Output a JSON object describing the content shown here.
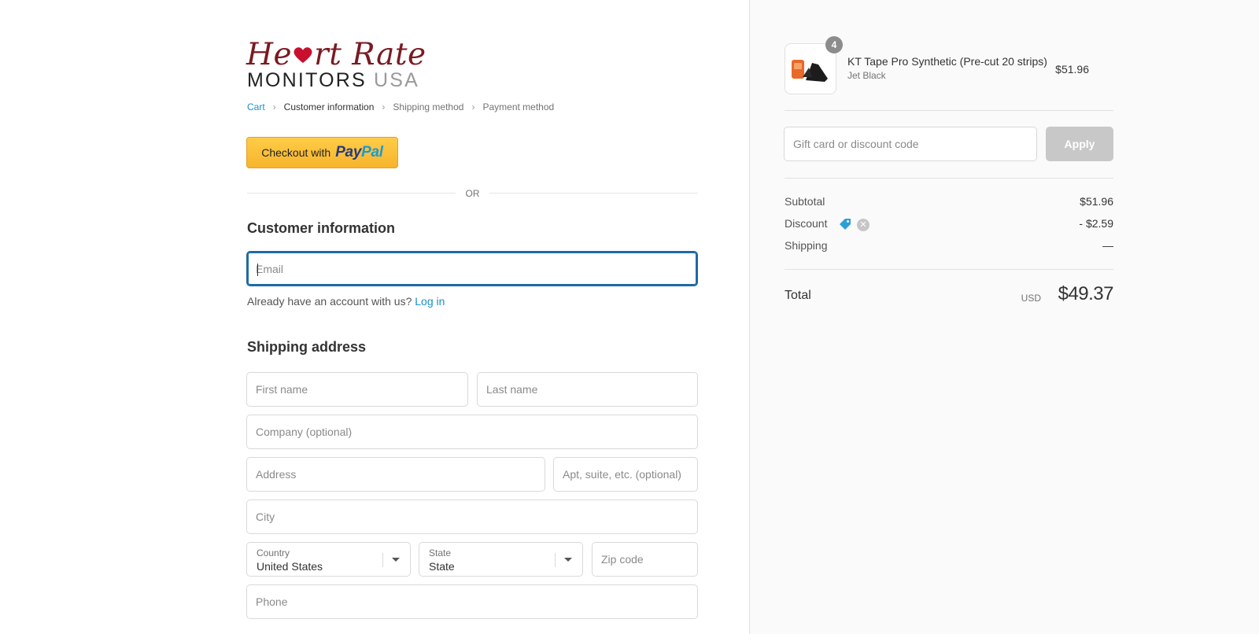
{
  "brand": {
    "logo_line1_left": "He",
    "logo_line1_right": "rt Rate",
    "logo_line2_main": "MONITORS",
    "logo_line2_suffix": "USA",
    "logo_color": "#7a1a22"
  },
  "breadcrumb": {
    "items": [
      {
        "label": "Cart",
        "state": "link"
      },
      {
        "label": "Customer information",
        "state": "current"
      },
      {
        "label": "Shipping method",
        "state": "upcoming"
      },
      {
        "label": "Payment method",
        "state": "upcoming"
      }
    ],
    "separator_icon": "chevron-right-icon"
  },
  "paypal": {
    "prefix": "Checkout with",
    "brand_part1": "Pay",
    "brand_part2": "Pal"
  },
  "divider_text": "OR",
  "customer_info": {
    "title": "Customer information",
    "email_placeholder": "Email",
    "email_value": "",
    "account_prompt": "Already have an account with us?",
    "login_link": "Log in"
  },
  "shipping": {
    "title": "Shipping address",
    "first_name_placeholder": "First name",
    "last_name_placeholder": "Last name",
    "company_placeholder": "Company (optional)",
    "address_placeholder": "Address",
    "apt_placeholder": "Apt, suite, etc. (optional)",
    "city_placeholder": "City",
    "country_label": "Country",
    "country_value": "United States",
    "state_label": "State",
    "state_value": "State",
    "zip_placeholder": "Zip code",
    "phone_placeholder": "Phone"
  },
  "order": {
    "product": {
      "name": "KT Tape Pro Synthetic (Pre-cut 20 strips)",
      "variant": "Jet Black",
      "price": "$51.96",
      "quantity": "4"
    },
    "discount_placeholder": "Gift card or discount code",
    "apply_label": "Apply",
    "subtotal_label": "Subtotal",
    "subtotal_value": "$51.96",
    "discount_label": "Discount",
    "discount_value": "- $2.59",
    "shipping_label": "Shipping",
    "shipping_value": "—",
    "total_label": "Total",
    "currency": "USD",
    "total_value": "$49.37"
  },
  "colors": {
    "link": "#1990c6",
    "focus_border": "#1f6aa3",
    "paypal_gold": "#f6b42c",
    "apply_disabled": "#c8c8c8",
    "discount_tag": "#2b9fd6"
  }
}
